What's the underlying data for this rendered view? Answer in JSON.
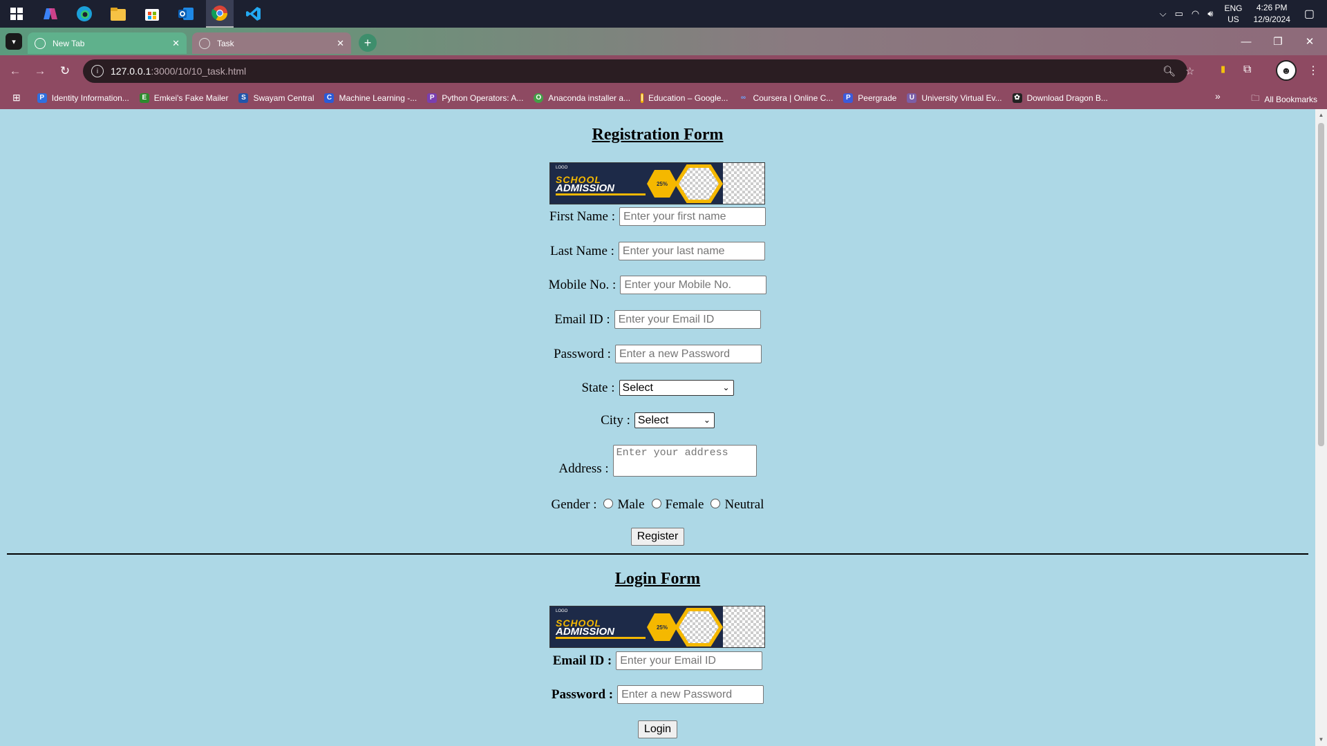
{
  "taskbar": {
    "apps": [
      "windows-start",
      "copilot",
      "edge",
      "file-explorer",
      "microsoft-store",
      "outlook",
      "chrome",
      "vscode"
    ],
    "lang_top": "ENG",
    "lang_bottom": "US",
    "time": "4:26 PM",
    "date": "12/9/2024"
  },
  "browser": {
    "tabs": [
      {
        "title": "New Tab",
        "active": false
      },
      {
        "title": "Task",
        "active": true
      }
    ],
    "url_host": "127.0.0.1",
    "url_path": ":3000/10/10_task.html",
    "bookmarks": [
      {
        "label": "Identity Information...",
        "icon_color": "#2f6fe0",
        "glyph": "P"
      },
      {
        "label": "Emkei's Fake Mailer",
        "icon_color": "#2e8b2e",
        "glyph": "E"
      },
      {
        "label": "Swayam Central",
        "icon_color": "#2255aa",
        "glyph": "S"
      },
      {
        "label": "Machine Learning -...",
        "icon_color": "#2a5bd7",
        "glyph": "C"
      },
      {
        "label": "Python Operators: A...",
        "icon_color": "#7a3fb0",
        "glyph": "P"
      },
      {
        "label": "Anaconda installer a...",
        "icon_color": "#43a047",
        "glyph": "O"
      },
      {
        "label": "Education – Google...",
        "icon_color": "#f4b400",
        "glyph": "|"
      },
      {
        "label": "Coursera | Online C...",
        "icon_color": "#3f7bd6",
        "glyph": "∞"
      },
      {
        "label": "Peergrade",
        "icon_color": "#3b5bdb",
        "glyph": "P"
      },
      {
        "label": "University Virtual Ev...",
        "icon_color": "#7b5ea7",
        "glyph": "U"
      },
      {
        "label": "Download Dragon B...",
        "icon_color": "#222222",
        "glyph": "✿"
      }
    ],
    "all_bookmarks": "All Bookmarks"
  },
  "registration": {
    "title": "Registration Form",
    "banner": {
      "logo": "LOGO",
      "line1": "SCHOOL",
      "line2": "ADMISSION",
      "badge": "25%"
    },
    "first_name_label": "First Name :",
    "first_name_placeholder": "Enter your first name",
    "last_name_label": "Last Name :",
    "last_name_placeholder": "Enter your last name",
    "mobile_label": "Mobile No. :",
    "mobile_placeholder": "Enter your Mobile No.",
    "email_label": "Email ID :",
    "email_placeholder": "Enter your Email ID",
    "password_label": "Password :",
    "password_placeholder": "Enter a new Password",
    "state_label": "State :",
    "state_value": "Select",
    "city_label": "City :",
    "city_value": "Select",
    "address_label": "Address :",
    "address_placeholder": "Enter your address",
    "gender_label": "Gender :",
    "gender_options": [
      "Male",
      "Female",
      "Neutral"
    ],
    "register_button": "Register"
  },
  "login": {
    "title": "Login Form",
    "email_label": "Email ID :",
    "email_placeholder": "Enter your Email ID",
    "password_label": "Password :",
    "password_placeholder": "Enter a new Password",
    "login_button": "Login"
  }
}
